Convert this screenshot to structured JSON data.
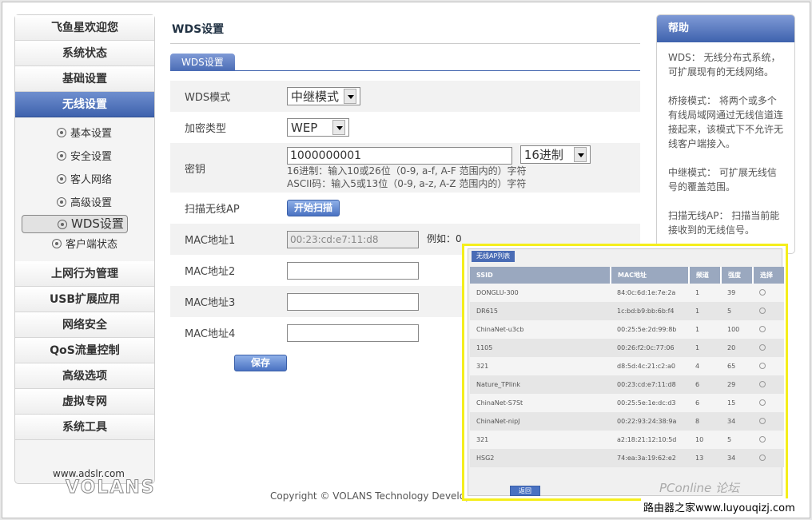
{
  "sidebar": {
    "welcome": "飞鱼星欢迎您",
    "top_items": [
      "系统状态",
      "基础设置"
    ],
    "active": "无线设置",
    "sub_items": [
      "基本设置",
      "安全设置",
      "客人网络",
      "高级设置",
      "WDS设置",
      "客户端状态"
    ],
    "bottom_items": [
      "上网行为管理",
      "USB扩展应用",
      "网络安全",
      "QoS流量控制",
      "高级选项",
      "虚拟专网",
      "系统工具"
    ]
  },
  "logo": {
    "url": "www.adslr.com",
    "word": "VOLANS"
  },
  "main": {
    "title": "WDS设置",
    "tab": "WDS设置",
    "mode_label": "WDS模式",
    "mode_value": "中继模式",
    "enc_label": "加密类型",
    "enc_value": "WEP",
    "key_label": "密钥",
    "key_value": "1000000001",
    "key_format": "16进制",
    "hint1": "16进制：输入10或26位（0-9, a-f, A-F 范围内的）字符",
    "hint2": "ASCII码：输入5或13位（0-9, a-z, A-Z 范围内的）字符",
    "scan_label": "扫描无线AP",
    "scan_button": "开始扫描",
    "mac1_label": "MAC地址1",
    "mac1_value": "00:23:cd:e7:11:d8",
    "mac1_example": "例如：0",
    "mac2_label": "MAC地址2",
    "mac3_label": "MAC地址3",
    "mac4_label": "MAC地址4",
    "save_button": "保存"
  },
  "copyright": "Copyright © VOLANS Technology Develop",
  "help": {
    "title": "帮助",
    "p1": "WDS：  无线分布式系统，可扩展现有的无线网络。",
    "p2": "桥接模式：  将两个或多个有线局域网通过无线信道连接起来，该模式下不允许无线客户端接入。",
    "p3": "中继模式：  可扩展无线信号的覆盖范围。",
    "p4": "扫描无线AP：  扫描当前能接收到的无线信号。"
  },
  "ap_list": {
    "title": "无线AP列表",
    "headers": [
      "SSID",
      "MAC地址",
      "频道",
      "强度",
      "选择"
    ],
    "rows": [
      [
        "DONGLU-300",
        "84:0c:6d:1e:7e:2a",
        "1",
        "39"
      ],
      [
        "DR615",
        "1c:bd:b9:bb:6b:f4",
        "1",
        "5"
      ],
      [
        "ChinaNet-u3cb",
        "00:25:5e:2d:99:8b",
        "1",
        "100"
      ],
      [
        "1105",
        "00:26:f2:0c:77:06",
        "1",
        "20"
      ],
      [
        "321",
        "d8:5d:4c:21:c2:a0",
        "4",
        "65"
      ],
      [
        "Nature_TPlink",
        "00:23:cd:e7:11:d8",
        "6",
        "29"
      ],
      [
        "ChinaNet-S7St",
        "00:25:5e:1e:dc:d3",
        "6",
        "15"
      ],
      [
        "ChinaNet-nipJ",
        "00:22:93:24:38:9a",
        "8",
        "34"
      ],
      [
        "321",
        "a2:18:21:12:10:5d",
        "10",
        "5"
      ],
      [
        "HSG2",
        "74:ea:3a:19:62:e2",
        "13",
        "34"
      ]
    ],
    "back_button": "返回"
  },
  "watermark": {
    "site": "路由器之家www.luyouqizj.com",
    "brand": "PConline 论坛"
  }
}
